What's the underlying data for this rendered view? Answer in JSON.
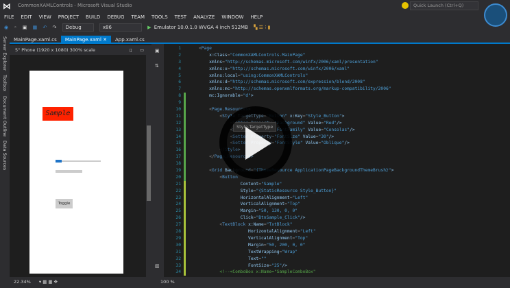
{
  "window": {
    "title": "CommonXAMLControls - Microsoft Visual Studio",
    "quick_launch_placeholder": "Quick Launch (Ctrl+Q)"
  },
  "menu": [
    "FILE",
    "EDIT",
    "VIEW",
    "PROJECT",
    "BUILD",
    "DEBUG",
    "TEAM",
    "TOOLS",
    "TEST",
    "ANALYZE",
    "WINDOW",
    "HELP"
  ],
  "toolbar": {
    "config": "Debug",
    "platform": "x86",
    "run_target": "Emulator 10.0.1.0 WVGA 4 inch 512MB"
  },
  "tabs": [
    {
      "label": "MainPage.xaml.cs",
      "active": false
    },
    {
      "label": "MainPage.xaml",
      "active": true
    },
    {
      "label": "App.xaml.cs",
      "active": false
    }
  ],
  "side_tabs": [
    "Server Explorer",
    "Toolbox",
    "Document Outline",
    "Data Sources"
  ],
  "designer": {
    "device": "5\" Phone (1920 x 1080) 300% scale",
    "sample_button": "Sample",
    "toggle_button": "Toggle",
    "slider_value_fraction": 0.12,
    "zoom": "22.34%"
  },
  "editor": {
    "zoom": "100 %",
    "tooltip": "Style.TargetType",
    "lines": [
      "<Page",
      "    x:Class=\"CommonXAMLControls.MainPage\"",
      "    xmlns=\"http://schemas.microsoft.com/winfx/2006/xaml/presentation\"",
      "    xmlns:x=\"http://schemas.microsoft.com/winfx/2006/xaml\"",
      "    xmlns:local=\"using:CommonXAMLControls\"",
      "    xmlns:d=\"http://schemas.microsoft.com/expression/blend/2008\"",
      "    xmlns:mc=\"http://schemas.openxmlformats.org/markup-compatibility/2006\"",
      "    mc:Ignorable=\"d\">",
      "",
      "    <Page.Resources>",
      "        <Style TargetType=\"Button\" x:Key=\"Style_Button\">",
      "            <Setter Property=\"Background\" Value=\"Red\"/>",
      "            <Setter Property=\"FontFamily\" Value=\"Consolas\"/>",
      "            <Setter Property=\"FontSize\" Value=\"30\"/>",
      "            <Setter Property=\"FontStyle\" Value=\"Oblique\"/>",
      "        </Style>",
      "    </Page.Resources>",
      "",
      "    <Grid Background=\"{ThemeResource ApplicationPageBackgroundThemeBrush}\">",
      "        <Button",
      "                Content=\"Sample\"",
      "                Style=\"{StaticResource Style_Button}\"",
      "                HorizontalAlignment=\"Left\"",
      "                VerticalAlignment=\"Top\"",
      "                Margin=\"50, 130, 0, 0\"",
      "                Click=\"BtnSample_Click\"/>",
      "        <TextBlock x:Name=\"TxtBlock\"",
      "                   HorizontalAlignment=\"Left\"",
      "                   VerticalAlignment=\"Top\"",
      "                   Margin=\"50, 200, 0, 0\"",
      "                   TextWrapping=\"Wrap\"",
      "                   Text=\"\"",
      "                   FontSize=\"25\"/>",
      "        <!--<ComboBox x:Name=\"SampleComboBox\""
    ]
  },
  "colors": {
    "accent": "#007acc",
    "editor_bg": "#1e1e1e",
    "sample_button_bg": "#ff2200",
    "line_numbers": "#2b91af"
  }
}
